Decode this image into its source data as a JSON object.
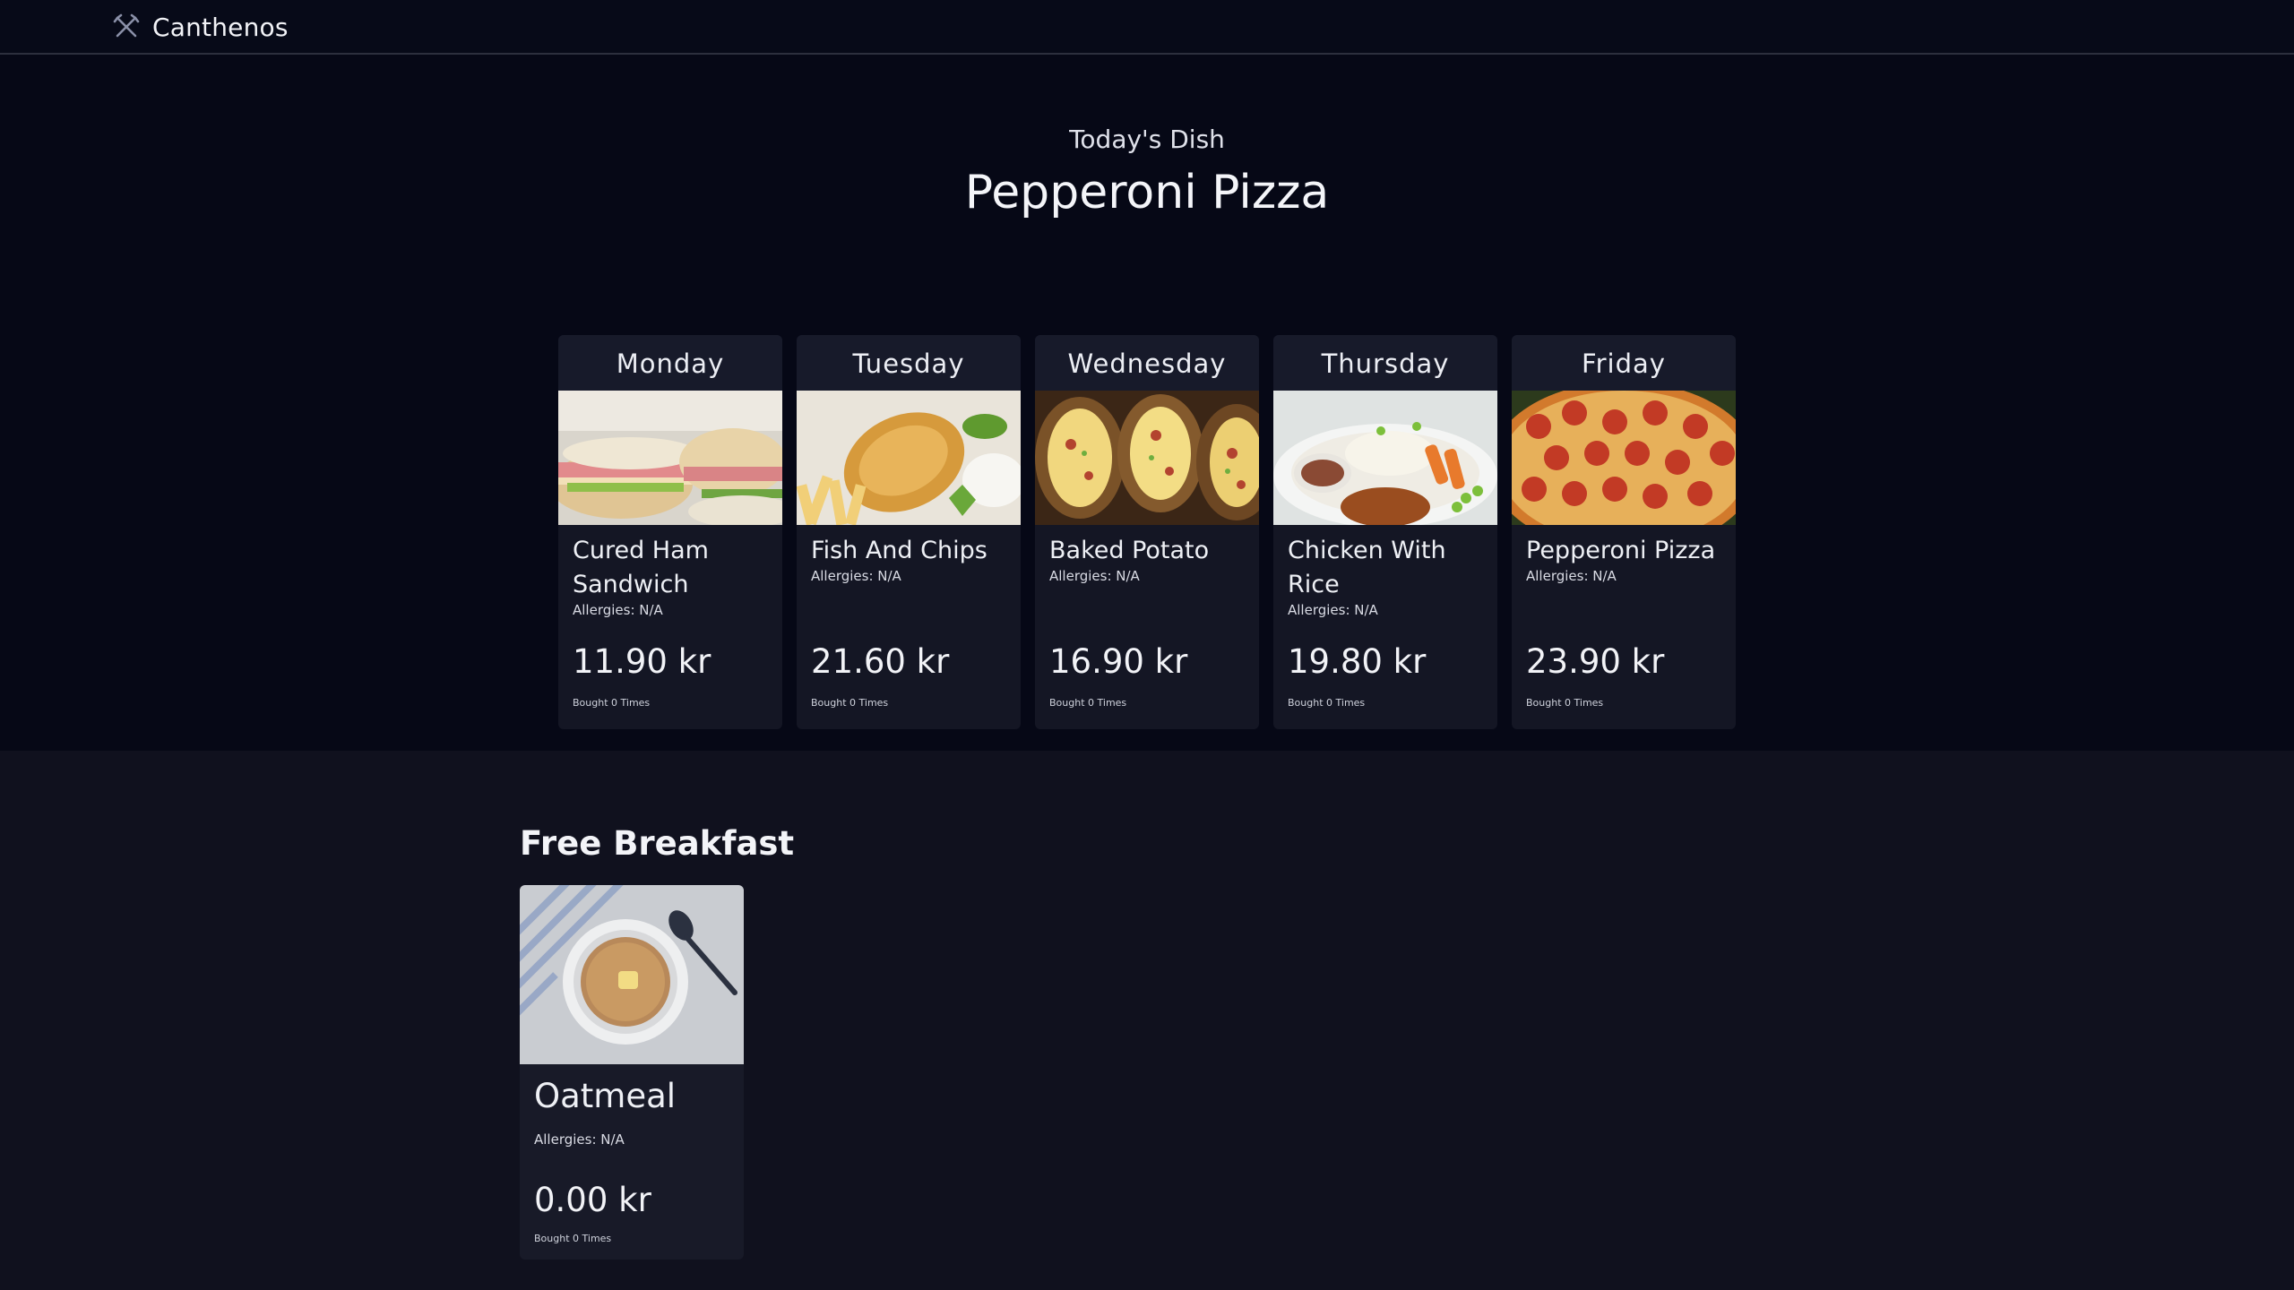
{
  "navbar": {
    "brand": "Canthenos",
    "brand_icon": "crossed-utensils-icon"
  },
  "hero": {
    "subtitle": "Today's Dish",
    "title": "Pepperoni Pizza"
  },
  "week": [
    {
      "day": "Monday",
      "dish": "Cured Ham Sandwich",
      "allergies": "Allergies: N/A",
      "price": "11.90 kr",
      "bought": "Bought 0 Times"
    },
    {
      "day": "Tuesday",
      "dish": "Fish And Chips",
      "allergies": "Allergies: N/A",
      "price": "21.60 kr",
      "bought": "Bought 0 Times"
    },
    {
      "day": "Wednesday",
      "dish": "Baked Potato",
      "allergies": "Allergies: N/A",
      "price": "16.90 kr",
      "bought": "Bought 0 Times"
    },
    {
      "day": "Thursday",
      "dish": "Chicken With Rice",
      "allergies": "Allergies: N/A",
      "price": "19.80 kr",
      "bought": "Bought 0 Times"
    },
    {
      "day": "Friday",
      "dish": "Pepperoni Pizza",
      "allergies": "Allergies: N/A",
      "price": "23.90 kr",
      "bought": "Bought 0 Times"
    }
  ],
  "breakfast": {
    "section_title": "Free Breakfast",
    "dish": "Oatmeal",
    "allergies": "Allergies: N/A",
    "price": "0.00 kr",
    "bought": "Bought 0 Times"
  },
  "colors": {
    "navbar_bg": "#070a18",
    "hero_bg": "#060816",
    "page_bg": "#10111e",
    "card_bg": "#141624",
    "text": "#e8e9ef"
  }
}
